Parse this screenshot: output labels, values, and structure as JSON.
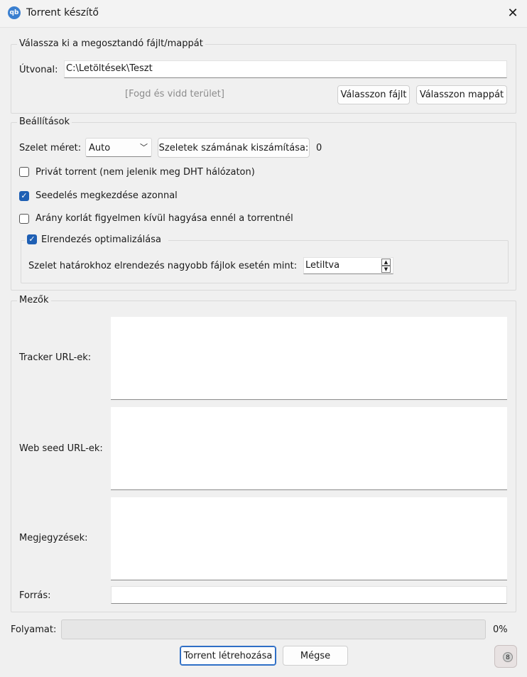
{
  "window": {
    "title": "Torrent készítő",
    "app_icon": "qb"
  },
  "file_group": {
    "title": "Válassza ki a megosztandó fájlt/mappát",
    "path_label": "Útvonal:",
    "path_value": "C:\\Letöltések\\Teszt",
    "drop_area": "[Fogd és vidd terület]",
    "select_file": "Válasszon fájlt",
    "select_folder": "Válasszon mappát"
  },
  "settings": {
    "title": "Beállítások",
    "piece_size_label": "Szelet méret:",
    "piece_size_value": "Auto",
    "calc_button": "Szeletek számának kiszámítása:",
    "piece_count": "0",
    "private_label": "Privát torrent (nem jelenik meg DHT hálózaton)",
    "private_checked": false,
    "seed_label": "Seedelés megkezdése azonnal",
    "seed_checked": true,
    "ratio_label": "Arány korlát figyelmen kívül hagyása ennél a torrentnél",
    "ratio_checked": false,
    "optimize_label": "Elrendezés optimalizálása",
    "optimize_checked": true,
    "align_label": "Szelet határokhoz elrendezés nagyobb fájlok esetén mint:",
    "align_value": "Letiltva"
  },
  "fields": {
    "title": "Mezők",
    "tracker_label": "Tracker URL-ek:",
    "webseed_label": "Web seed URL-ek:",
    "comments_label": "Megjegyzések:",
    "source_label": "Forrás:"
  },
  "progress": {
    "label": "Folyamat:",
    "value_text": "0%",
    "value": 0
  },
  "buttons": {
    "create": "Torrent létrehozása",
    "cancel": "Mégse"
  }
}
